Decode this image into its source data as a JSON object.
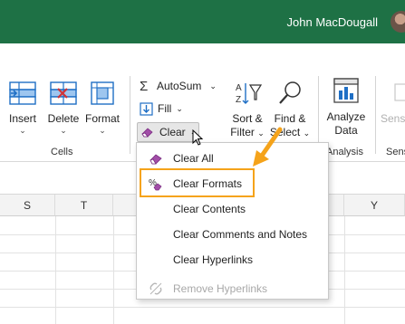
{
  "titlebar": {
    "user_name": "John MacDougall",
    "color": "#1e7145"
  },
  "ribbon": {
    "cells_group": {
      "label": "Cells",
      "insert": "Insert",
      "delete": "Delete",
      "format": "Format"
    },
    "editing_group": {
      "autosum": "AutoSum",
      "fill": "Fill",
      "clear": "Clear",
      "sort_filter_line1": "Sort &",
      "sort_filter_line2": "Filter",
      "find_select_line1": "Find &",
      "find_select_line2": "Select"
    },
    "analysis_group": {
      "label": "Analysis",
      "analyze_line1": "Analyze",
      "analyze_line2": "Data"
    },
    "sensitivity_group": {
      "label": "Sens",
      "button": "Sens"
    }
  },
  "grid": {
    "columns": [
      "S",
      "T",
      "Y"
    ]
  },
  "clear_menu": {
    "items": [
      {
        "label": "Clear All",
        "icon": "eraser-icon",
        "enabled": true
      },
      {
        "label": "Clear Formats",
        "icon": "percent-eraser-icon",
        "enabled": true,
        "highlighted": true
      },
      {
        "label": "Clear Contents",
        "icon": "",
        "enabled": true
      },
      {
        "label": "Clear Comments and Notes",
        "icon": "",
        "enabled": true
      },
      {
        "label": "Clear Hyperlinks",
        "icon": "",
        "enabled": true
      },
      {
        "label": "Remove Hyperlinks",
        "icon": "unlink-icon",
        "enabled": false
      }
    ]
  },
  "colors": {
    "highlight": "#f5a31a",
    "accent_green": "#1e7145",
    "eraser": "#a24ea8"
  }
}
